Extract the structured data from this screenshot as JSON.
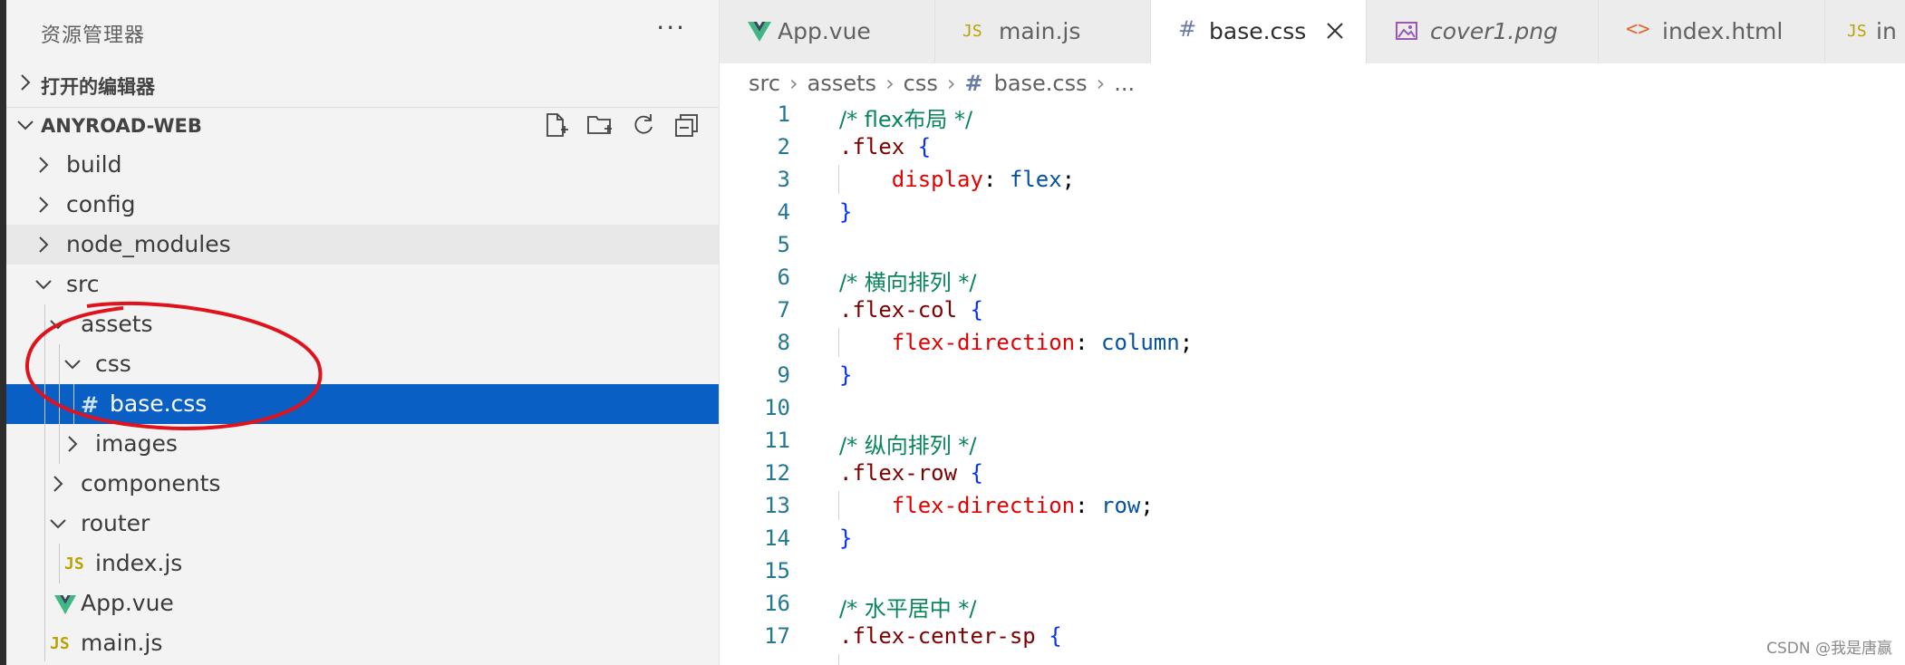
{
  "explorer": {
    "title": "资源管理器",
    "more_label": "···",
    "open_editors_label": "打开的编辑器",
    "project_label": "ANYROAD-WEB"
  },
  "tree": [
    {
      "label": "build"
    },
    {
      "label": "config"
    },
    {
      "label": "node_modules"
    },
    {
      "label": "src"
    },
    {
      "label": "assets"
    },
    {
      "label": "css"
    },
    {
      "label": "base.css",
      "icon_text": "#"
    },
    {
      "label": "images"
    },
    {
      "label": "components"
    },
    {
      "label": "router"
    },
    {
      "label": "index.js",
      "icon_text": "JS"
    },
    {
      "label": "App.vue"
    },
    {
      "label": "main.js",
      "icon_text": "JS"
    }
  ],
  "tabs": [
    {
      "label": "App.vue"
    },
    {
      "label": "main.js",
      "icon_text": "JS"
    },
    {
      "label": "base.css",
      "icon_text": "#"
    },
    {
      "label": "cover1.png"
    },
    {
      "label": "index.html",
      "icon_text": "<>"
    },
    {
      "label": "in",
      "icon_text": "JS"
    }
  ],
  "breadcrumb": {
    "parts": [
      "src",
      "assets",
      "css",
      "base.css",
      "..."
    ],
    "file_icon": "#"
  },
  "code_lines": [
    {
      "n": "1",
      "comment": "/* flex布局 */"
    },
    {
      "n": "2",
      "selector": ".flex",
      "brace": "{"
    },
    {
      "n": "3",
      "prop": "display",
      "val": "flex"
    },
    {
      "n": "4",
      "close": "}"
    },
    {
      "n": "5"
    },
    {
      "n": "6",
      "comment": "/* 横向排列 */"
    },
    {
      "n": "7",
      "selector": ".flex-col",
      "brace": "{"
    },
    {
      "n": "8",
      "prop": "flex-direction",
      "val": "column"
    },
    {
      "n": "9",
      "close": "}"
    },
    {
      "n": "10"
    },
    {
      "n": "11",
      "comment": "/* 纵向排列 */"
    },
    {
      "n": "12",
      "selector": ".flex-row",
      "brace": "{"
    },
    {
      "n": "13",
      "prop": "flex-direction",
      "val": "row"
    },
    {
      "n": "14",
      "close": "}"
    },
    {
      "n": "15"
    },
    {
      "n": "16",
      "comment": "/* 水平居中 */"
    },
    {
      "n": "17",
      "selector": ".flex-center-sp",
      "brace": "{"
    }
  ],
  "watermark": "CSDN @我是唐赢",
  "colors": {
    "selection": "#0a5fc4",
    "annotation": "#e0121b",
    "vue_green": "#41b883",
    "js_yellow": "#b9a300"
  }
}
